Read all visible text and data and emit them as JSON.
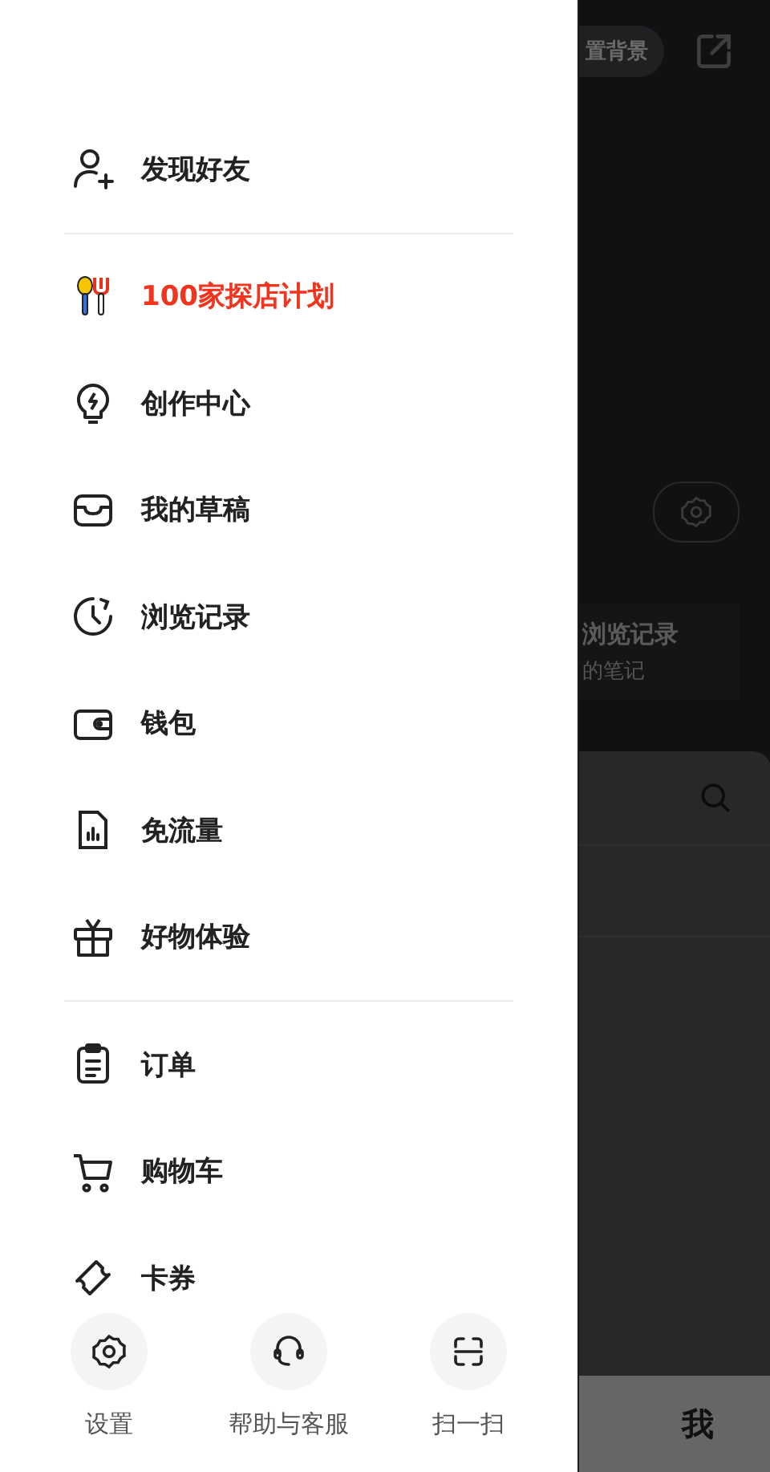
{
  "drawer": {
    "sections": [
      {
        "items": [
          {
            "label": "发现好友",
            "kind": "normal"
          }
        ]
      },
      {
        "items": [
          {
            "label": "100家探店计划",
            "kind": "promo"
          },
          {
            "label": "创作中心",
            "kind": "normal"
          },
          {
            "label": "我的草稿",
            "kind": "normal"
          },
          {
            "label": "浏览记录",
            "kind": "normal"
          },
          {
            "label": "钱包",
            "kind": "normal"
          },
          {
            "label": "免流量",
            "kind": "normal"
          },
          {
            "label": "好物体验",
            "kind": "normal"
          }
        ]
      },
      {
        "items": [
          {
            "label": "订单",
            "kind": "normal"
          },
          {
            "label": "购物车",
            "kind": "normal"
          },
          {
            "label": "卡券",
            "kind": "normal"
          }
        ]
      }
    ],
    "bottom_actions": [
      {
        "label": "设置"
      },
      {
        "label": "帮助与客服"
      },
      {
        "label": "扫一扫"
      }
    ]
  },
  "background": {
    "background_button": "置背景",
    "history_card": {
      "title": "浏览记录",
      "subtitle": "的笔记"
    },
    "tab": "我"
  }
}
